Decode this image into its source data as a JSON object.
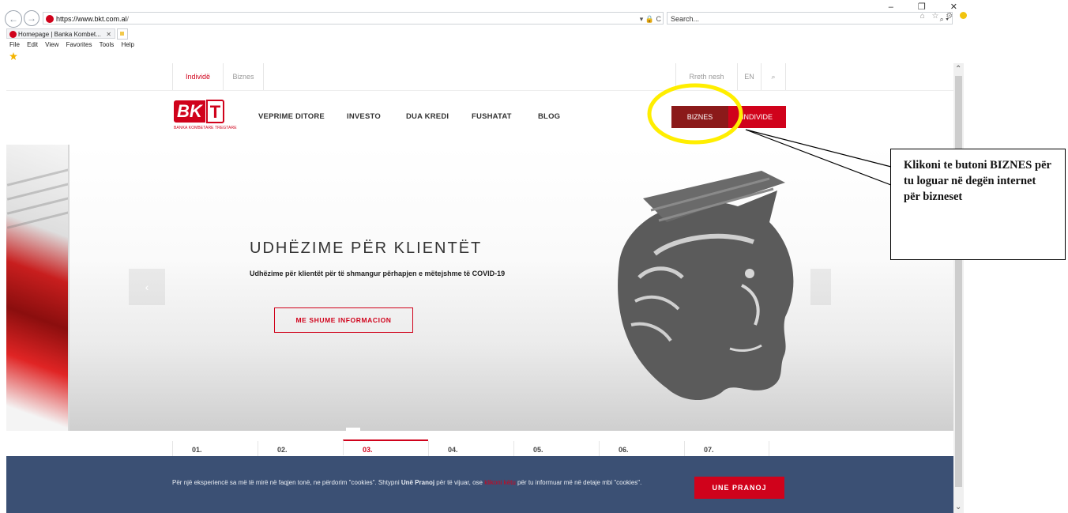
{
  "browser": {
    "url_host": "https://www.bkt.com.al",
    "url_rest": "/",
    "url_tools": "▾ 🔒 C",
    "search_placeholder": "Search...",
    "search_glyph": "⌕ ▾",
    "window_controls": "–  ❐  ✕",
    "right_icons": "⌂ ☆ ⚙",
    "tab_title": "Homepage | Banka Kombet...",
    "tab_close": "✕",
    "menu": [
      "File",
      "Edit",
      "View",
      "Favorites",
      "Tools",
      "Help"
    ]
  },
  "topnav": {
    "individe": "Individë",
    "biznes": "Biznes",
    "rreth": "Rreth nesh",
    "lang": "EN",
    "search_glyph": "⌕"
  },
  "logo": {
    "bk": "BK",
    "kt": "T",
    "subtitle": "BANKA KOMBETARE TREGTARE"
  },
  "mainnav": {
    "items": [
      "VEPRIME DITORE",
      "INVESTO",
      "DUA KREDI",
      "FUSHATAT",
      "BLOG"
    ],
    "biznes_btn": "BIZNES",
    "individe_btn": "INDIVIDE"
  },
  "hero": {
    "title": "UDHËZIME PËR KLIENTËT",
    "desc": "Udhëzime për klientët për të shmangur përhapjen e mëtejshme të COVID-19",
    "cta": "ME SHUME INFORMACION",
    "prev_glyph": "‹"
  },
  "slides": [
    "01.",
    "02.",
    "03.",
    "04.",
    "05.",
    "06.",
    "07."
  ],
  "active_slide": 2,
  "cookie": {
    "text_before": "Për një eksperiencë sa më të mirë në faqjen tonë, ne përdorim \"cookies\". Shtypni ",
    "bold": "Unë Pranoj",
    "text_mid": " për të vijuar, ose ",
    "link": "klikoni këtu",
    "text_after": " për tu informuar më në detaje mbi \"cookies\".",
    "button": "UNE PRANOJ"
  },
  "annotation": {
    "text": "Klikoni te butoni BIZNES  për tu loguar në degën internet për bizneset",
    "highlight_color": "#ffee00"
  },
  "colors": {
    "brand_red": "#d0021b",
    "dark_red": "#8b1a1a",
    "cookie_bg": "#3b5074"
  }
}
